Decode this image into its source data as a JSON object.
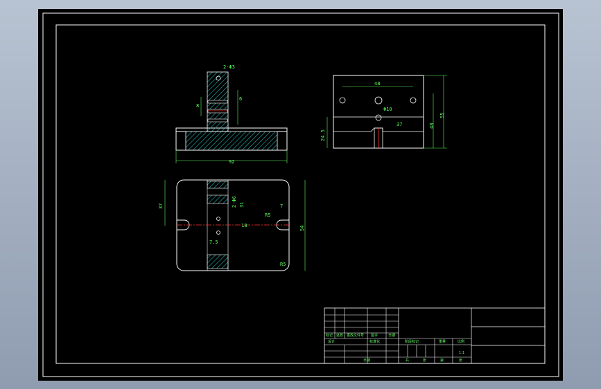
{
  "drawing": {
    "front_view": {
      "dims": {
        "top_hole": "2-Φ3",
        "slot_left": "8",
        "slot_right": "6",
        "width": "92"
      }
    },
    "side_view": {
      "dims": {
        "hole_spacing": "48",
        "hole_dia": "Φ10",
        "height_total": "55",
        "height_mid": "48",
        "depth": "37",
        "base_height": "24.5"
      }
    },
    "top_view": {
      "dims": {
        "left_height": "37",
        "slot_top": "2-Φ6",
        "slot_mid": "31",
        "center_offset": "18",
        "notch": "7",
        "right_height": "54",
        "rad_left": "R5",
        "small_gap": "7.5",
        "corner": "R5"
      }
    },
    "title_block": {
      "left_labels": [
        "标记",
        "处数",
        "更改文件号",
        "签字",
        "日期"
      ],
      "row2_labels": [
        "设计",
        "标准化"
      ],
      "approval_label": "日期",
      "mid_labels": [
        "阶段标记",
        "重量",
        "比例"
      ],
      "scale": "1:1",
      "bottom_labels": [
        "共",
        "张",
        "第",
        "张"
      ]
    }
  }
}
